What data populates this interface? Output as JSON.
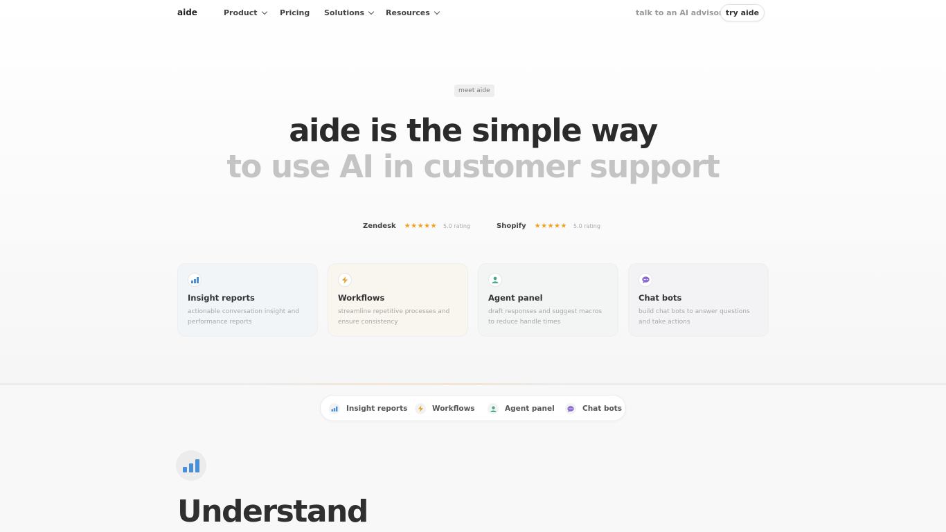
{
  "nav": {
    "logo": "aide",
    "items": [
      {
        "label": "Product",
        "dropdown": true
      },
      {
        "label": "Pricing",
        "dropdown": false
      },
      {
        "label": "Solutions",
        "dropdown": true
      },
      {
        "label": "Resources",
        "dropdown": true
      }
    ],
    "advisor_link": "talk to an AI advisor",
    "cta": "try aide"
  },
  "hero": {
    "badge": "meet aide",
    "headline_line1": "aide is the simple way",
    "headline_line2": "to use AI in customer support"
  },
  "ratings": [
    {
      "platform": "Zendesk",
      "stars": "★★★★★",
      "score": "5.0 rating"
    },
    {
      "platform": "Shopify",
      "stars": "★★★★★",
      "score": "5.0 rating"
    }
  ],
  "features": [
    {
      "title": "Insight reports",
      "description": "actionable conversation insight and performance reports",
      "icon": "bar-chart-icon",
      "bg": "#f2f5f8",
      "accent": "#4a8fd6"
    },
    {
      "title": "Workflows",
      "description": "streamline repetitive processes and ensure consistency",
      "icon": "lightning-icon",
      "bg": "#f9f5ef",
      "accent": "#e0a52a"
    },
    {
      "title": "Agent panel",
      "description": "draft responses and suggest macros to reduce handle times",
      "icon": "person-icon",
      "bg": "#f2f5f4",
      "accent": "#4aa88f"
    },
    {
      "title": "Chat bots",
      "description": "build chat bots to answer questions and take actions",
      "icon": "chat-bubble-icon",
      "bg": "#f3f3f6",
      "accent": "#8a6ad0"
    }
  ],
  "tabs": [
    {
      "label": "Insight reports",
      "icon": "bar-chart-icon"
    },
    {
      "label": "Workflows",
      "icon": "lightning-icon"
    },
    {
      "label": "Agent panel",
      "icon": "person-icon"
    },
    {
      "label": "Chat bots",
      "icon": "chat-bubble-icon"
    }
  ],
  "section": {
    "icon": "bar-chart-icon",
    "title": "Understand"
  }
}
